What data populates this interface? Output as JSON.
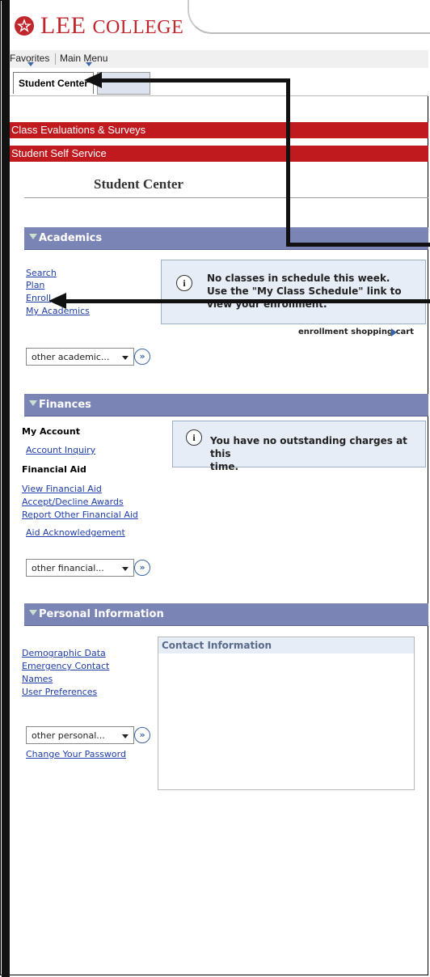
{
  "brand": {
    "logo_text_big": "LEE",
    "logo_text_small": "COLLEGE",
    "color": "#c0272d"
  },
  "menubar": {
    "favorites": "Favorites",
    "main_menu": "Main Menu"
  },
  "tabs": {
    "active": "Student Center",
    "inactive": "..."
  },
  "red_bars": [
    "Class Evaluations & Surveys",
    "Student Self Service"
  ],
  "page_title": "Student Center",
  "academics": {
    "header": "Academics",
    "links": [
      "Search",
      "Plan",
      "Enroll",
      "My Academics"
    ],
    "notice": {
      "line1": "No classes in schedule this week.",
      "line2": "Use the \"My Class Schedule\" link to",
      "line3": "view your enrollment."
    },
    "cart_link": "enrollment shopping cart",
    "select": "other academic..."
  },
  "finances": {
    "header": "Finances",
    "my_account": "My Account",
    "account_inquiry": "Account Inquiry",
    "financial_aid": "Financial Aid",
    "aid_links": [
      "View Financial Aid",
      "Accept/Decline Awards",
      "Report Other Financial Aid",
      "Aid Acknowledgement"
    ],
    "notice": {
      "line1": "You have no outstanding charges at this",
      "line2": "time."
    },
    "select": "other financial..."
  },
  "personal": {
    "header": "Personal Information",
    "links": [
      "Demographic Data",
      "Emergency Contact",
      "Names",
      "User Preferences"
    ],
    "select": "other personal...",
    "change_password": "Change Your Password",
    "contact_header": "Contact Information"
  },
  "colors": {
    "red_bar": "#c01a1f",
    "section_header": "#7b85b5",
    "link": "#1f3da8",
    "notice_bg": "#e6edf6"
  }
}
